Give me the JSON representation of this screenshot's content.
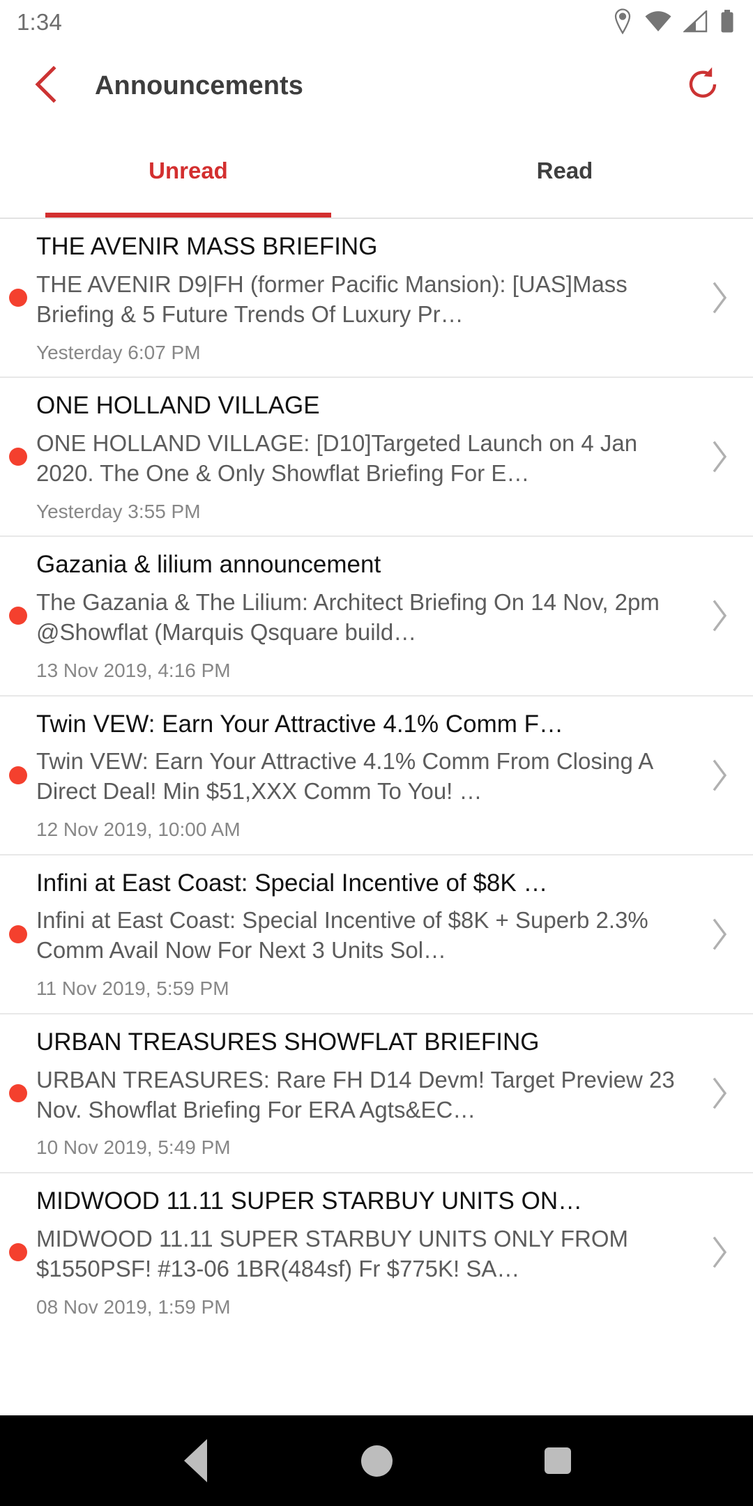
{
  "status_bar": {
    "time": "1:34",
    "icons": [
      "location-pin-icon",
      "wifi-icon",
      "cellular-signal-icon",
      "battery-icon"
    ]
  },
  "app_bar": {
    "back_icon": "chevron-left-icon",
    "title": "Announcements",
    "refresh_icon": "refresh-icon",
    "accent_color": "#d32f2f"
  },
  "tabs": {
    "items": [
      {
        "label": "Unread",
        "active": true
      },
      {
        "label": "Read",
        "active": false
      }
    ],
    "active_color": "#d32f2f",
    "inactive_color": "#3f3f3f"
  },
  "list": {
    "unread_dot_color": "#f4402e",
    "chevron_icon": "chevron-right-icon",
    "items": [
      {
        "title": "THE AVENIR MASS BRIEFING",
        "snippet": "THE AVENIR D9|FH (former Pacific Mansion): [UAS]Mass Briefing & 5 Future Trends Of Luxury Pr…",
        "time": "Yesterday 6:07 PM",
        "unread": true
      },
      {
        "title": "ONE HOLLAND VILLAGE",
        "snippet": "ONE HOLLAND VILLAGE: [D10]Targeted Launch on 4 Jan 2020. The One & Only Showflat Briefing For E…",
        "time": "Yesterday 3:55 PM",
        "unread": true
      },
      {
        "title": "Gazania & lilium announcement",
        "snippet": "The Gazania & The Lilium: Architect Briefing On 14 Nov, 2pm @Showflat (Marquis Qsquare build…",
        "time": "13 Nov 2019, 4:16 PM",
        "unread": true
      },
      {
        "title": "Twin VEW: Earn Your Attractive 4.1% Comm F…",
        "snippet": "Twin VEW: Earn Your Attractive 4.1% Comm From Closing A Direct Deal! Min $51,XXX Comm To You! …",
        "time": "12 Nov 2019, 10:00 AM",
        "unread": true
      },
      {
        "title": "Infini at East Coast: Special Incentive of $8K …",
        "snippet": "Infini at East Coast: Special Incentive of $8K + Superb 2.3% Comm Avail Now For Next 3 Units Sol…",
        "time": "11 Nov 2019, 5:59 PM",
        "unread": true
      },
      {
        "title": "URBAN TREASURES SHOWFLAT BRIEFING",
        "snippet": "URBAN TREASURES: Rare FH D14 Devm! Target Preview 23 Nov. Showflat Briefing For ERA Agts&EC…",
        "time": "10 Nov 2019, 5:49 PM",
        "unread": true
      },
      {
        "title": "MIDWOOD 11.11 SUPER STARBUY UNITS ON…",
        "snippet": "MIDWOOD 11.11 SUPER STARBUY UNITS ONLY FROM $1550PSF! #13-06 1BR(484sf) Fr $775K! SA…",
        "time": "08 Nov 2019, 1:59 PM",
        "unread": true
      }
    ]
  },
  "navigation_bar": {
    "back_label": "back-button",
    "home_label": "home-button",
    "recents_label": "recents-button"
  }
}
